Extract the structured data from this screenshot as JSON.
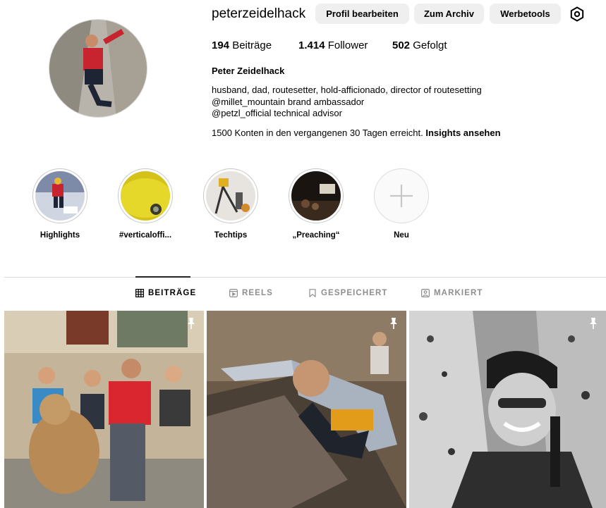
{
  "profile": {
    "username": "peterzeidelhack",
    "full_name": "Peter Zeidelhack",
    "bio_lines": [
      "husband, dad, routesetter, hold-afficionado, director of routesetting",
      "@millet_mountain brand ambassador",
      "@petzl_official technical advisor"
    ],
    "insights_text": "1500 Konten in den vergangenen 30 Tagen erreicht.",
    "insights_link": "Insights ansehen"
  },
  "buttons": {
    "edit_profile": "Profil bearbeiten",
    "archive": "Zum Archiv",
    "ad_tools": "Werbetools"
  },
  "stats": {
    "posts_count": "194",
    "posts_label": "Beiträge",
    "followers_count": "1.414",
    "followers_label": "Follower",
    "following_count": "502",
    "following_label": "Gefolgt"
  },
  "highlights": [
    {
      "label": "Highlights"
    },
    {
      "label": "#verticaloffi..."
    },
    {
      "label": "Techtips"
    },
    {
      "label": "„Preaching“"
    },
    {
      "label": "Neu"
    }
  ],
  "tabs": [
    {
      "label": "BEITRÄGE",
      "active": true
    },
    {
      "label": "REELS",
      "active": false
    },
    {
      "label": "GESPEICHERT",
      "active": false
    },
    {
      "label": "MARKIERT",
      "active": false
    }
  ],
  "posts": [
    {
      "pinned": true
    },
    {
      "pinned": true
    },
    {
      "pinned": true
    }
  ],
  "icons": {
    "settings": "gear-icon",
    "new_highlight": "plus-icon",
    "tab_posts": "grid-icon",
    "tab_reels": "reels-icon",
    "tab_saved": "bookmark-icon",
    "tab_tagged": "tag-icon",
    "pinned": "pin-icon"
  },
  "colors": {
    "button_bg": "#efefef",
    "divider": "#dbdbdb",
    "muted_text": "#8e8e8e"
  }
}
